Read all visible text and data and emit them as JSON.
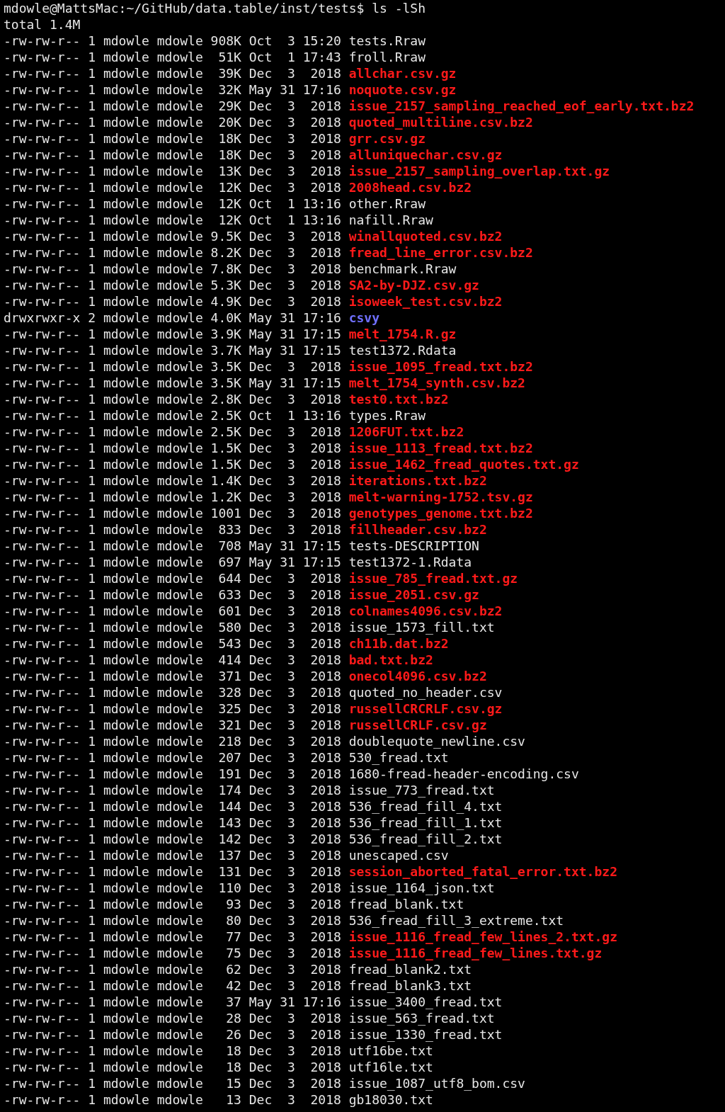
{
  "prompt": {
    "text": "mdowle@MattsMac:~/GitHub/data.table/inst/tests$ ls -lSh"
  },
  "total": "total 1.4M",
  "entries": [
    {
      "perms": "-rw-rw-r--",
      "links": "1",
      "owner": "mdowle",
      "group": "mdowle",
      "size": "908K",
      "month": "Oct",
      "day": "3",
      "time": "15:20",
      "name": "tests.Rraw",
      "kind": "file"
    },
    {
      "perms": "-rw-rw-r--",
      "links": "1",
      "owner": "mdowle",
      "group": "mdowle",
      "size": "51K",
      "month": "Oct",
      "day": "1",
      "time": "17:43",
      "name": "froll.Rraw",
      "kind": "file"
    },
    {
      "perms": "-rw-rw-r--",
      "links": "1",
      "owner": "mdowle",
      "group": "mdowle",
      "size": "39K",
      "month": "Dec",
      "day": "3",
      "time": "2018",
      "name": "allchar.csv.gz",
      "kind": "archive"
    },
    {
      "perms": "-rw-rw-r--",
      "links": "1",
      "owner": "mdowle",
      "group": "mdowle",
      "size": "32K",
      "month": "May",
      "day": "31",
      "time": "17:16",
      "name": "noquote.csv.gz",
      "kind": "archive"
    },
    {
      "perms": "-rw-rw-r--",
      "links": "1",
      "owner": "mdowle",
      "group": "mdowle",
      "size": "29K",
      "month": "Dec",
      "day": "3",
      "time": "2018",
      "name": "issue_2157_sampling_reached_eof_early.txt.bz2",
      "kind": "archive"
    },
    {
      "perms": "-rw-rw-r--",
      "links": "1",
      "owner": "mdowle",
      "group": "mdowle",
      "size": "20K",
      "month": "Dec",
      "day": "3",
      "time": "2018",
      "name": "quoted_multiline.csv.bz2",
      "kind": "archive"
    },
    {
      "perms": "-rw-rw-r--",
      "links": "1",
      "owner": "mdowle",
      "group": "mdowle",
      "size": "18K",
      "month": "Dec",
      "day": "3",
      "time": "2018",
      "name": "grr.csv.gz",
      "kind": "archive"
    },
    {
      "perms": "-rw-rw-r--",
      "links": "1",
      "owner": "mdowle",
      "group": "mdowle",
      "size": "18K",
      "month": "Dec",
      "day": "3",
      "time": "2018",
      "name": "alluniquechar.csv.gz",
      "kind": "archive"
    },
    {
      "perms": "-rw-rw-r--",
      "links": "1",
      "owner": "mdowle",
      "group": "mdowle",
      "size": "13K",
      "month": "Dec",
      "day": "3",
      "time": "2018",
      "name": "issue_2157_sampling_overlap.txt.gz",
      "kind": "archive"
    },
    {
      "perms": "-rw-rw-r--",
      "links": "1",
      "owner": "mdowle",
      "group": "mdowle",
      "size": "12K",
      "month": "Dec",
      "day": "3",
      "time": "2018",
      "name": "2008head.csv.bz2",
      "kind": "archive"
    },
    {
      "perms": "-rw-rw-r--",
      "links": "1",
      "owner": "mdowle",
      "group": "mdowle",
      "size": "12K",
      "month": "Oct",
      "day": "1",
      "time": "13:16",
      "name": "other.Rraw",
      "kind": "file"
    },
    {
      "perms": "-rw-rw-r--",
      "links": "1",
      "owner": "mdowle",
      "group": "mdowle",
      "size": "12K",
      "month": "Oct",
      "day": "1",
      "time": "13:16",
      "name": "nafill.Rraw",
      "kind": "file"
    },
    {
      "perms": "-rw-rw-r--",
      "links": "1",
      "owner": "mdowle",
      "group": "mdowle",
      "size": "9.5K",
      "month": "Dec",
      "day": "3",
      "time": "2018",
      "name": "winallquoted.csv.bz2",
      "kind": "archive"
    },
    {
      "perms": "-rw-rw-r--",
      "links": "1",
      "owner": "mdowle",
      "group": "mdowle",
      "size": "8.2K",
      "month": "Dec",
      "day": "3",
      "time": "2018",
      "name": "fread_line_error.csv.bz2",
      "kind": "archive"
    },
    {
      "perms": "-rw-rw-r--",
      "links": "1",
      "owner": "mdowle",
      "group": "mdowle",
      "size": "7.8K",
      "month": "Dec",
      "day": "3",
      "time": "2018",
      "name": "benchmark.Rraw",
      "kind": "file"
    },
    {
      "perms": "-rw-rw-r--",
      "links": "1",
      "owner": "mdowle",
      "group": "mdowle",
      "size": "5.3K",
      "month": "Dec",
      "day": "3",
      "time": "2018",
      "name": "SA2-by-DJZ.csv.gz",
      "kind": "archive"
    },
    {
      "perms": "-rw-rw-r--",
      "links": "1",
      "owner": "mdowle",
      "group": "mdowle",
      "size": "4.9K",
      "month": "Dec",
      "day": "3",
      "time": "2018",
      "name": "isoweek_test.csv.bz2",
      "kind": "archive"
    },
    {
      "perms": "drwxrwxr-x",
      "links": "2",
      "owner": "mdowle",
      "group": "mdowle",
      "size": "4.0K",
      "month": "May",
      "day": "31",
      "time": "17:16",
      "name": "csvy",
      "kind": "directory"
    },
    {
      "perms": "-rw-rw-r--",
      "links": "1",
      "owner": "mdowle",
      "group": "mdowle",
      "size": "3.9K",
      "month": "May",
      "day": "31",
      "time": "17:15",
      "name": "melt_1754.R.gz",
      "kind": "archive"
    },
    {
      "perms": "-rw-rw-r--",
      "links": "1",
      "owner": "mdowle",
      "group": "mdowle",
      "size": "3.7K",
      "month": "May",
      "day": "31",
      "time": "17:15",
      "name": "test1372.Rdata",
      "kind": "file"
    },
    {
      "perms": "-rw-rw-r--",
      "links": "1",
      "owner": "mdowle",
      "group": "mdowle",
      "size": "3.5K",
      "month": "Dec",
      "day": "3",
      "time": "2018",
      "name": "issue_1095_fread.txt.bz2",
      "kind": "archive"
    },
    {
      "perms": "-rw-rw-r--",
      "links": "1",
      "owner": "mdowle",
      "group": "mdowle",
      "size": "3.5K",
      "month": "May",
      "day": "31",
      "time": "17:15",
      "name": "melt_1754_synth.csv.bz2",
      "kind": "archive"
    },
    {
      "perms": "-rw-rw-r--",
      "links": "1",
      "owner": "mdowle",
      "group": "mdowle",
      "size": "2.8K",
      "month": "Dec",
      "day": "3",
      "time": "2018",
      "name": "test0.txt.bz2",
      "kind": "archive"
    },
    {
      "perms": "-rw-rw-r--",
      "links": "1",
      "owner": "mdowle",
      "group": "mdowle",
      "size": "2.5K",
      "month": "Oct",
      "day": "1",
      "time": "13:16",
      "name": "types.Rraw",
      "kind": "file"
    },
    {
      "perms": "-rw-rw-r--",
      "links": "1",
      "owner": "mdowle",
      "group": "mdowle",
      "size": "2.5K",
      "month": "Dec",
      "day": "3",
      "time": "2018",
      "name": "1206FUT.txt.bz2",
      "kind": "archive"
    },
    {
      "perms": "-rw-rw-r--",
      "links": "1",
      "owner": "mdowle",
      "group": "mdowle",
      "size": "1.5K",
      "month": "Dec",
      "day": "3",
      "time": "2018",
      "name": "issue_1113_fread.txt.bz2",
      "kind": "archive"
    },
    {
      "perms": "-rw-rw-r--",
      "links": "1",
      "owner": "mdowle",
      "group": "mdowle",
      "size": "1.5K",
      "month": "Dec",
      "day": "3",
      "time": "2018",
      "name": "issue_1462_fread_quotes.txt.gz",
      "kind": "archive"
    },
    {
      "perms": "-rw-rw-r--",
      "links": "1",
      "owner": "mdowle",
      "group": "mdowle",
      "size": "1.4K",
      "month": "Dec",
      "day": "3",
      "time": "2018",
      "name": "iterations.txt.bz2",
      "kind": "archive"
    },
    {
      "perms": "-rw-rw-r--",
      "links": "1",
      "owner": "mdowle",
      "group": "mdowle",
      "size": "1.2K",
      "month": "Dec",
      "day": "3",
      "time": "2018",
      "name": "melt-warning-1752.tsv.gz",
      "kind": "archive"
    },
    {
      "perms": "-rw-rw-r--",
      "links": "1",
      "owner": "mdowle",
      "group": "mdowle",
      "size": "1001",
      "month": "Dec",
      "day": "3",
      "time": "2018",
      "name": "genotypes_genome.txt.bz2",
      "kind": "archive"
    },
    {
      "perms": "-rw-rw-r--",
      "links": "1",
      "owner": "mdowle",
      "group": "mdowle",
      "size": "833",
      "month": "Dec",
      "day": "3",
      "time": "2018",
      "name": "fillheader.csv.bz2",
      "kind": "archive"
    },
    {
      "perms": "-rw-rw-r--",
      "links": "1",
      "owner": "mdowle",
      "group": "mdowle",
      "size": "708",
      "month": "May",
      "day": "31",
      "time": "17:15",
      "name": "tests-DESCRIPTION",
      "kind": "file"
    },
    {
      "perms": "-rw-rw-r--",
      "links": "1",
      "owner": "mdowle",
      "group": "mdowle",
      "size": "697",
      "month": "May",
      "day": "31",
      "time": "17:15",
      "name": "test1372-1.Rdata",
      "kind": "file"
    },
    {
      "perms": "-rw-rw-r--",
      "links": "1",
      "owner": "mdowle",
      "group": "mdowle",
      "size": "644",
      "month": "Dec",
      "day": "3",
      "time": "2018",
      "name": "issue_785_fread.txt.gz",
      "kind": "archive"
    },
    {
      "perms": "-rw-rw-r--",
      "links": "1",
      "owner": "mdowle",
      "group": "mdowle",
      "size": "633",
      "month": "Dec",
      "day": "3",
      "time": "2018",
      "name": "issue_2051.csv.gz",
      "kind": "archive"
    },
    {
      "perms": "-rw-rw-r--",
      "links": "1",
      "owner": "mdowle",
      "group": "mdowle",
      "size": "601",
      "month": "Dec",
      "day": "3",
      "time": "2018",
      "name": "colnames4096.csv.bz2",
      "kind": "archive"
    },
    {
      "perms": "-rw-rw-r--",
      "links": "1",
      "owner": "mdowle",
      "group": "mdowle",
      "size": "580",
      "month": "Dec",
      "day": "3",
      "time": "2018",
      "name": "issue_1573_fill.txt",
      "kind": "file"
    },
    {
      "perms": "-rw-rw-r--",
      "links": "1",
      "owner": "mdowle",
      "group": "mdowle",
      "size": "543",
      "month": "Dec",
      "day": "3",
      "time": "2018",
      "name": "ch11b.dat.bz2",
      "kind": "archive"
    },
    {
      "perms": "-rw-rw-r--",
      "links": "1",
      "owner": "mdowle",
      "group": "mdowle",
      "size": "414",
      "month": "Dec",
      "day": "3",
      "time": "2018",
      "name": "bad.txt.bz2",
      "kind": "archive"
    },
    {
      "perms": "-rw-rw-r--",
      "links": "1",
      "owner": "mdowle",
      "group": "mdowle",
      "size": "371",
      "month": "Dec",
      "day": "3",
      "time": "2018",
      "name": "onecol4096.csv.bz2",
      "kind": "archive"
    },
    {
      "perms": "-rw-rw-r--",
      "links": "1",
      "owner": "mdowle",
      "group": "mdowle",
      "size": "328",
      "month": "Dec",
      "day": "3",
      "time": "2018",
      "name": "quoted_no_header.csv",
      "kind": "file"
    },
    {
      "perms": "-rw-rw-r--",
      "links": "1",
      "owner": "mdowle",
      "group": "mdowle",
      "size": "325",
      "month": "Dec",
      "day": "3",
      "time": "2018",
      "name": "russellCRCRLF.csv.gz",
      "kind": "archive"
    },
    {
      "perms": "-rw-rw-r--",
      "links": "1",
      "owner": "mdowle",
      "group": "mdowle",
      "size": "321",
      "month": "Dec",
      "day": "3",
      "time": "2018",
      "name": "russellCRLF.csv.gz",
      "kind": "archive"
    },
    {
      "perms": "-rw-rw-r--",
      "links": "1",
      "owner": "mdowle",
      "group": "mdowle",
      "size": "218",
      "month": "Dec",
      "day": "3",
      "time": "2018",
      "name": "doublequote_newline.csv",
      "kind": "file"
    },
    {
      "perms": "-rw-rw-r--",
      "links": "1",
      "owner": "mdowle",
      "group": "mdowle",
      "size": "207",
      "month": "Dec",
      "day": "3",
      "time": "2018",
      "name": "530_fread.txt",
      "kind": "file"
    },
    {
      "perms": "-rw-rw-r--",
      "links": "1",
      "owner": "mdowle",
      "group": "mdowle",
      "size": "191",
      "month": "Dec",
      "day": "3",
      "time": "2018",
      "name": "1680-fread-header-encoding.csv",
      "kind": "file"
    },
    {
      "perms": "-rw-rw-r--",
      "links": "1",
      "owner": "mdowle",
      "group": "mdowle",
      "size": "174",
      "month": "Dec",
      "day": "3",
      "time": "2018",
      "name": "issue_773_fread.txt",
      "kind": "file"
    },
    {
      "perms": "-rw-rw-r--",
      "links": "1",
      "owner": "mdowle",
      "group": "mdowle",
      "size": "144",
      "month": "Dec",
      "day": "3",
      "time": "2018",
      "name": "536_fread_fill_4.txt",
      "kind": "file"
    },
    {
      "perms": "-rw-rw-r--",
      "links": "1",
      "owner": "mdowle",
      "group": "mdowle",
      "size": "143",
      "month": "Dec",
      "day": "3",
      "time": "2018",
      "name": "536_fread_fill_1.txt",
      "kind": "file"
    },
    {
      "perms": "-rw-rw-r--",
      "links": "1",
      "owner": "mdowle",
      "group": "mdowle",
      "size": "142",
      "month": "Dec",
      "day": "3",
      "time": "2018",
      "name": "536_fread_fill_2.txt",
      "kind": "file"
    },
    {
      "perms": "-rw-rw-r--",
      "links": "1",
      "owner": "mdowle",
      "group": "mdowle",
      "size": "137",
      "month": "Dec",
      "day": "3",
      "time": "2018",
      "name": "unescaped.csv",
      "kind": "file"
    },
    {
      "perms": "-rw-rw-r--",
      "links": "1",
      "owner": "mdowle",
      "group": "mdowle",
      "size": "131",
      "month": "Dec",
      "day": "3",
      "time": "2018",
      "name": "session_aborted_fatal_error.txt.bz2",
      "kind": "archive"
    },
    {
      "perms": "-rw-rw-r--",
      "links": "1",
      "owner": "mdowle",
      "group": "mdowle",
      "size": "110",
      "month": "Dec",
      "day": "3",
      "time": "2018",
      "name": "issue_1164_json.txt",
      "kind": "file"
    },
    {
      "perms": "-rw-rw-r--",
      "links": "1",
      "owner": "mdowle",
      "group": "mdowle",
      "size": "93",
      "month": "Dec",
      "day": "3",
      "time": "2018",
      "name": "fread_blank.txt",
      "kind": "file"
    },
    {
      "perms": "-rw-rw-r--",
      "links": "1",
      "owner": "mdowle",
      "group": "mdowle",
      "size": "80",
      "month": "Dec",
      "day": "3",
      "time": "2018",
      "name": "536_fread_fill_3_extreme.txt",
      "kind": "file"
    },
    {
      "perms": "-rw-rw-r--",
      "links": "1",
      "owner": "mdowle",
      "group": "mdowle",
      "size": "77",
      "month": "Dec",
      "day": "3",
      "time": "2018",
      "name": "issue_1116_fread_few_lines_2.txt.gz",
      "kind": "archive"
    },
    {
      "perms": "-rw-rw-r--",
      "links": "1",
      "owner": "mdowle",
      "group": "mdowle",
      "size": "75",
      "month": "Dec",
      "day": "3",
      "time": "2018",
      "name": "issue_1116_fread_few_lines.txt.gz",
      "kind": "archive"
    },
    {
      "perms": "-rw-rw-r--",
      "links": "1",
      "owner": "mdowle",
      "group": "mdowle",
      "size": "62",
      "month": "Dec",
      "day": "3",
      "time": "2018",
      "name": "fread_blank2.txt",
      "kind": "file"
    },
    {
      "perms": "-rw-rw-r--",
      "links": "1",
      "owner": "mdowle",
      "group": "mdowle",
      "size": "42",
      "month": "Dec",
      "day": "3",
      "time": "2018",
      "name": "fread_blank3.txt",
      "kind": "file"
    },
    {
      "perms": "-rw-rw-r--",
      "links": "1",
      "owner": "mdowle",
      "group": "mdowle",
      "size": "37",
      "month": "May",
      "day": "31",
      "time": "17:16",
      "name": "issue_3400_fread.txt",
      "kind": "file"
    },
    {
      "perms": "-rw-rw-r--",
      "links": "1",
      "owner": "mdowle",
      "group": "mdowle",
      "size": "28",
      "month": "Dec",
      "day": "3",
      "time": "2018",
      "name": "issue_563_fread.txt",
      "kind": "file"
    },
    {
      "perms": "-rw-rw-r--",
      "links": "1",
      "owner": "mdowle",
      "group": "mdowle",
      "size": "26",
      "month": "Dec",
      "day": "3",
      "time": "2018",
      "name": "issue_1330_fread.txt",
      "kind": "file"
    },
    {
      "perms": "-rw-rw-r--",
      "links": "1",
      "owner": "mdowle",
      "group": "mdowle",
      "size": "18",
      "month": "Dec",
      "day": "3",
      "time": "2018",
      "name": "utf16be.txt",
      "kind": "file"
    },
    {
      "perms": "-rw-rw-r--",
      "links": "1",
      "owner": "mdowle",
      "group": "mdowle",
      "size": "18",
      "month": "Dec",
      "day": "3",
      "time": "2018",
      "name": "utf16le.txt",
      "kind": "file"
    },
    {
      "perms": "-rw-rw-r--",
      "links": "1",
      "owner": "mdowle",
      "group": "mdowle",
      "size": "15",
      "month": "Dec",
      "day": "3",
      "time": "2018",
      "name": "issue_1087_utf8_bom.csv",
      "kind": "file"
    },
    {
      "perms": "-rw-rw-r--",
      "links": "1",
      "owner": "mdowle",
      "group": "mdowle",
      "size": "13",
      "month": "Dec",
      "day": "3",
      "time": "2018",
      "name": "gb18030.txt",
      "kind": "file"
    }
  ]
}
